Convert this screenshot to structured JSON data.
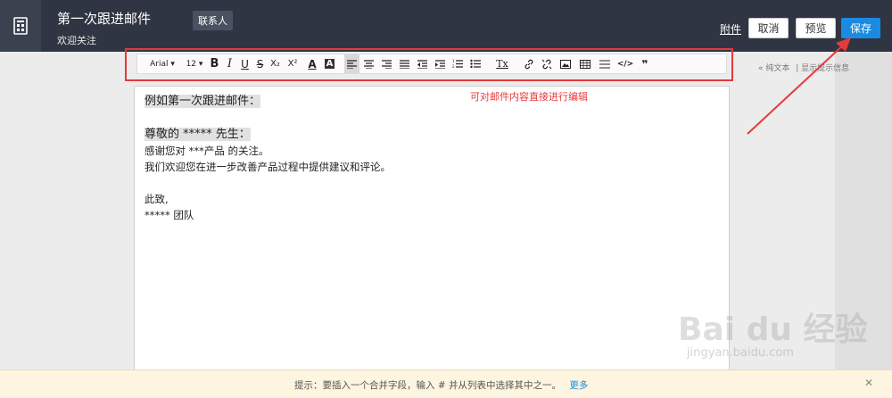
{
  "header": {
    "title": "第一次跟进邮件",
    "subtitle": "欢迎关注",
    "tag": "联系人",
    "attach_label": "附件",
    "cancel_label": "取消",
    "preview_label": "预览",
    "save_label": "保存"
  },
  "toolbar": {
    "font": "Arial",
    "size": "12",
    "bold": "B",
    "italic": "I",
    "underline": "U",
    "strike": "S",
    "subscript": "X₂",
    "superscript": "X²",
    "text_color": "A",
    "bg_color": "A",
    "clear_format": "Tx",
    "code": "</>",
    "quote": "❞"
  },
  "side_links": {
    "plain_text": "« 纯文本",
    "show_hints": "| 显示提示信息"
  },
  "editor": {
    "line1": "例如第一次跟进邮件：",
    "line2": "尊敬的 ***** 先生：",
    "line3": "感谢您对 ***产品 的关注。",
    "line4": "我们欢迎您在进一步改善产品过程中提供建议和评论。",
    "line5": "此致,",
    "line6": "***** 团队"
  },
  "annotation": "可对邮件内容直接进行编辑",
  "tip": {
    "text": "提示：要插入一个合并字段，输入 # 并从列表中选择其中之一。",
    "more": "更多",
    "close": "✕"
  },
  "watermark": {
    "brand": "Bai du 经验",
    "url": "jingyan.baidu.com"
  },
  "colors": {
    "header_bg": "#2f3542",
    "save_button": "#1a8be0",
    "annotation_red": "#e53a3a"
  }
}
